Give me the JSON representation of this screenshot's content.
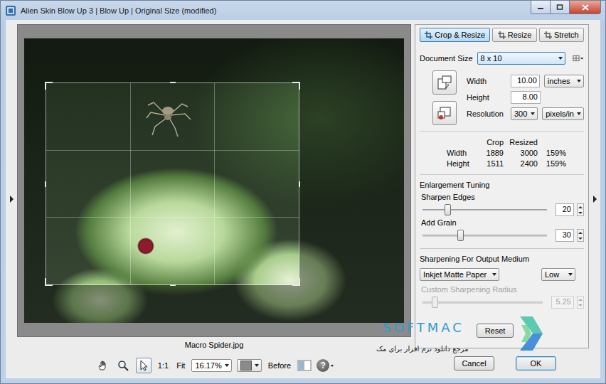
{
  "window": {
    "title": "Alien Skin Blow Up 3 | Blow Up | Original Size (modified)"
  },
  "preview": {
    "caption": "Macro Spider.jpg"
  },
  "toolbar": {
    "tools": [
      {
        "selected": false
      },
      {
        "selected": false
      },
      {
        "selected": true
      }
    ],
    "actual_size": "1:1",
    "fit": "Fit",
    "zoom": "16.17%",
    "compare": "Before",
    "help": "?"
  },
  "tabs": [
    {
      "label": "Crop & Resize",
      "selected": true
    },
    {
      "label": "Resize",
      "selected": false
    },
    {
      "label": "Stretch",
      "selected": false
    }
  ],
  "document_size": {
    "label": "Document Size",
    "value": "8 x 10"
  },
  "dimensions": {
    "width": {
      "label": "Width",
      "value": "10.00"
    },
    "height": {
      "label": "Height",
      "value": "8.00"
    },
    "units": "inches",
    "resolution": {
      "label": "Resolution",
      "value": "300",
      "units": "pixels/in"
    }
  },
  "size_table": {
    "columns": [
      "Crop",
      "Resized"
    ],
    "rows": [
      {
        "label": "Width",
        "crop": "1889",
        "resized": "3000",
        "percent": "159%"
      },
      {
        "label": "Height",
        "crop": "1511",
        "resized": "2400",
        "percent": "159%"
      }
    ]
  },
  "tuning": {
    "title": "Enlargement Tuning",
    "sliders": [
      {
        "label": "Sharpen Edges",
        "value": "20",
        "level": 0.2,
        "disabled": false
      },
      {
        "label": "Add Grain",
        "value": "30",
        "level": 0.3,
        "disabled": false
      }
    ]
  },
  "output": {
    "title": "Sharpening For Output Medium",
    "medium": "Inkjet Matte Paper",
    "strength": "Low",
    "custom_radius": {
      "label": "Custom Sharpening Radius",
      "value": "5.25",
      "level": 0.1,
      "disabled": true
    }
  },
  "reset": "Reset",
  "buttons": [
    {
      "label": "Cancel",
      "default": false
    },
    {
      "label": "OK",
      "default": true
    }
  ],
  "watermark": {
    "brand": "SOFTMAC",
    "tagline": "مرجع دانلود نرم افزار برای مک"
  }
}
